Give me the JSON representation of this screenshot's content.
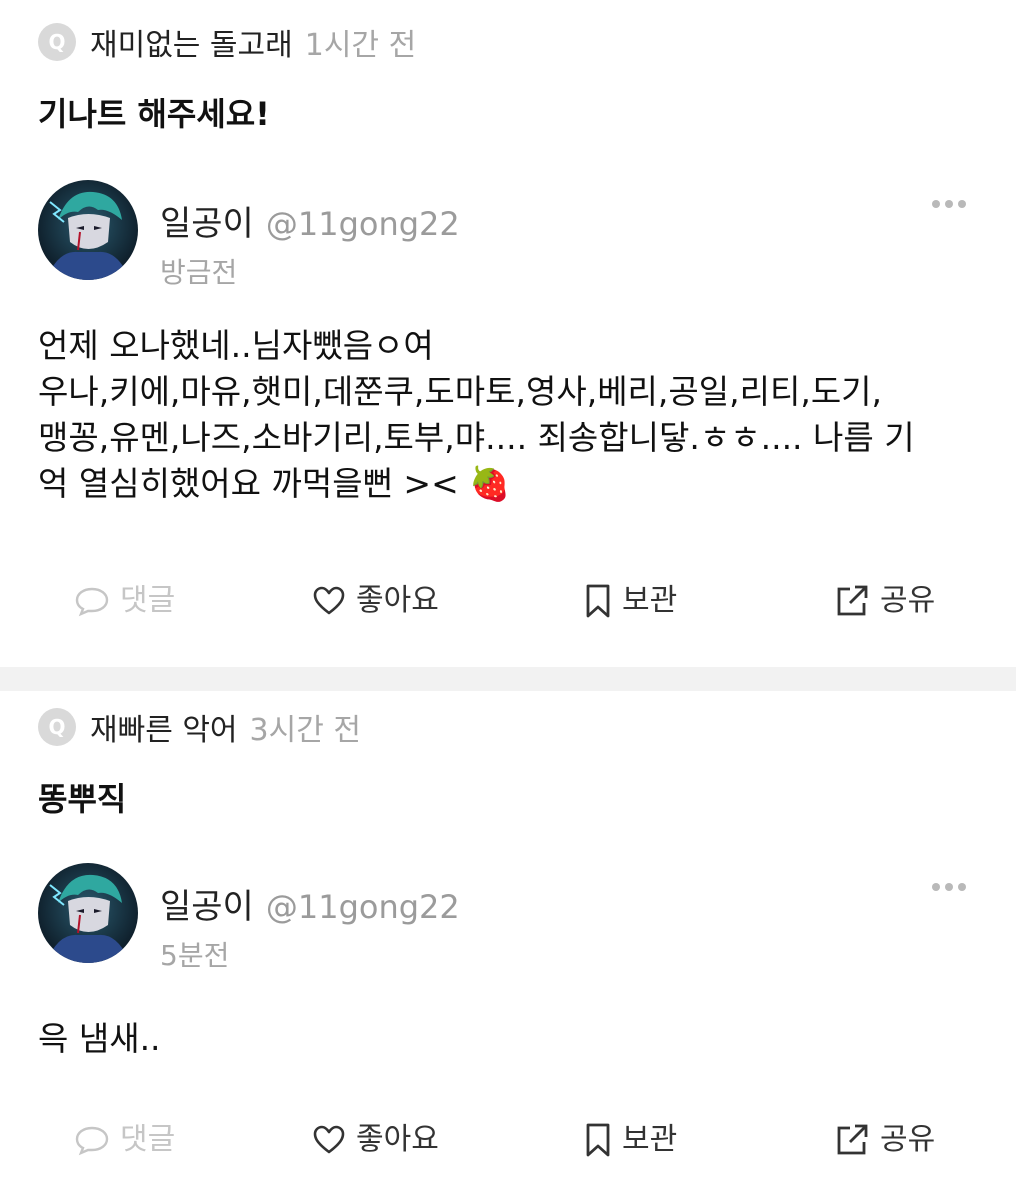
{
  "posts": [
    {
      "q_badge": "Q",
      "asker": "재미없는 돌고래",
      "q_time": "1시간 전",
      "question": "기나트 해주세요!",
      "username": "일공이",
      "handle": "@11gong22",
      "answer_time": "방금전",
      "answer": "언제 오나했네..님자뺐음ㅇ여\n우나,키에,마유,햇미,데쭌쿠,도마토,영사,베리,공일,리티,도기,\n맹꽁,유멘,나즈,소바기리,토부,먀.... 죄송합니닿.ㅎㅎ.... 나름 기\n억 열심히했어요 까먹을뻔 >< 🍓",
      "actions": {
        "comment": "댓글",
        "like": "좋아요",
        "save": "보관",
        "share": "공유"
      }
    },
    {
      "q_badge": "Q",
      "asker": "재빠른 악어",
      "q_time": "3시간 전",
      "question": "똥뿌직",
      "username": "일공이",
      "handle": "@11gong22",
      "answer_time": "5분전",
      "answer": "윽 냄새..",
      "actions": {
        "comment": "댓글",
        "like": "좋아요",
        "save": "보관",
        "share": "공유"
      }
    }
  ],
  "icons": {
    "q": "q-badge-icon",
    "more": "more-dots-icon",
    "comment": "comment-bubble-icon",
    "like": "heart-icon",
    "save": "bookmark-icon",
    "share": "share-external-icon",
    "strawberry": "strawberry-emoji"
  },
  "colors": {
    "muted": "#a6a6a6",
    "disabled": "#c6c6c6",
    "divider": "#f2f2f2"
  }
}
